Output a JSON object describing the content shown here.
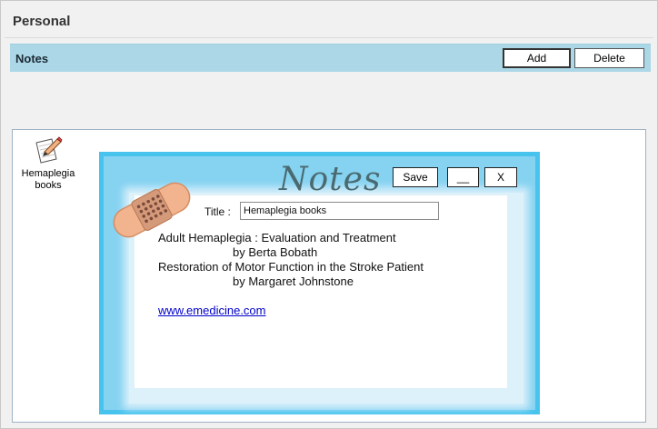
{
  "page": {
    "title": "Personal"
  },
  "notes_panel": {
    "label": "Notes",
    "add_label": "Add",
    "delete_label": "Delete"
  },
  "items": [
    {
      "title": "Hemaplegia books",
      "icon": "note-pencil-icon"
    }
  ],
  "popup": {
    "heading": "Notes",
    "save_label": "Save",
    "minimize_label": "__",
    "close_label": "X",
    "title_label": "Title :",
    "title_value": "Hemaplegia books",
    "body_lines": [
      "Adult Hemaplegia : Evaluation and Treatment",
      "by Berta Bobath",
      "Restoration of Motor Function in the Stroke Patient",
      "by Margaret Johnstone"
    ],
    "link": "www.emedicine.com",
    "decoration": "bandage-icon"
  },
  "colors": {
    "header_bg": "#abd7e6",
    "popup_border": "#48c3ee",
    "popup_inner": "#85d2f1",
    "link": "#0000cc"
  }
}
